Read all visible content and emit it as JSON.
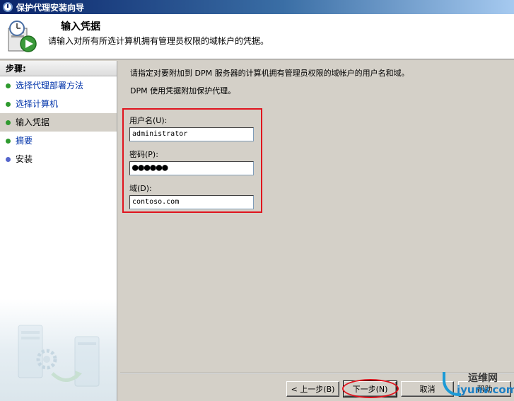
{
  "window": {
    "title": "保护代理安装向导"
  },
  "header": {
    "title": "输入凭据",
    "subtitle": "请输入对所有所选计算机拥有管理员权限的域帐户的凭据。"
  },
  "steps": {
    "heading": "步骤:",
    "items": [
      {
        "label": "选择代理部署方法",
        "state": "done"
      },
      {
        "label": "选择计算机",
        "state": "done"
      },
      {
        "label": "输入凭据",
        "state": "current"
      },
      {
        "label": "摘要",
        "state": "done"
      },
      {
        "label": "安装",
        "state": "pending"
      }
    ]
  },
  "content": {
    "intro_line1": "请指定对要附加到 DPM 服务器的计算机拥有管理员权限的域帐户的用户名和域。",
    "intro_line2": "DPM 使用凭据附加保护代理。",
    "username_label": "用户名(U):",
    "username_value": "administrator",
    "password_label": "密码(P):",
    "password_value": "●●●●●●",
    "domain_label": "域(D):",
    "domain_value": "contoso.com"
  },
  "buttons": {
    "back": "< 上一步(B)",
    "next": "下一步(N)",
    "cancel": "取消",
    "help": "帮助"
  },
  "watermark": {
    "top": "运维网",
    "bottom": "iyunv.com"
  },
  "colors": {
    "highlight": "#e0141e",
    "title_bar": "#0a246a"
  }
}
